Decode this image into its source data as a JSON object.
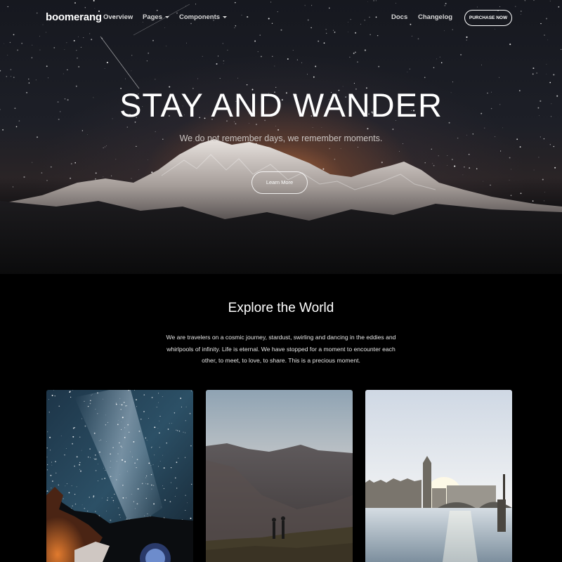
{
  "nav": {
    "logo": "boomerang",
    "overview": "Overview",
    "pages": "Pages",
    "components": "Components",
    "docs": "Docs",
    "changelog": "Changelog",
    "purchase": "PURCHASE NOW"
  },
  "hero": {
    "title": "STAY AND WANDER",
    "subtitle": "We do not remember days, we remember moments.",
    "button": "Learn More"
  },
  "explore": {
    "title": "Explore the World",
    "text": "We are travelers on a cosmic journey, stardust, swirling and dancing in the eddies and whirlpools of infinity. Life is eternal. We have stopped for a moment to encounter each other, to meet, to love, to share. This is a precious moment."
  }
}
